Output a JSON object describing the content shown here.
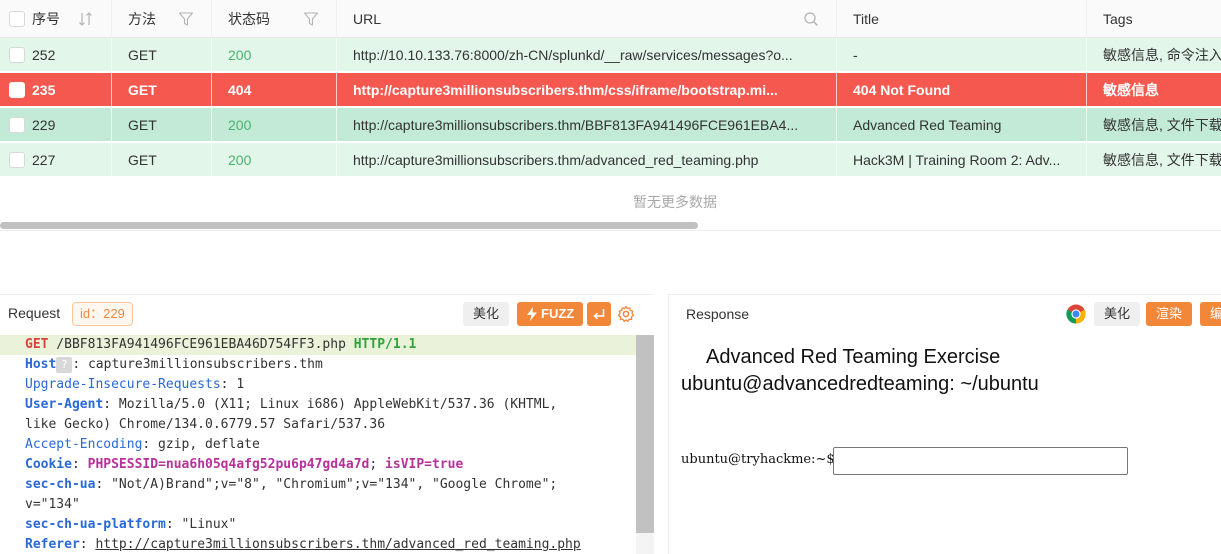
{
  "table": {
    "columns": {
      "index": "序号",
      "method": "方法",
      "status": "状态码",
      "url": "URL",
      "title": "Title",
      "tags": "Tags"
    },
    "rows": [
      {
        "index": "252",
        "method": "GET",
        "status": "200",
        "url": "http://10.10.133.76:8000/zh-CN/splunkd/__raw/services/messages?o...",
        "title": "-",
        "tags": "敏感信息, 命令注入",
        "state": "normal"
      },
      {
        "index": "235",
        "method": "GET",
        "status": "404",
        "url": "http://capture3millionsubscribers.thm/css/iframe/bootstrap.mi...",
        "title": "404 Not Found",
        "tags": "敏感信息",
        "state": "error-selected"
      },
      {
        "index": "229",
        "method": "GET",
        "status": "200",
        "url": "http://capture3millionsubscribers.thm/BBF813FA941496FCE961EBA4...",
        "title": "Advanced Red Teaming",
        "tags": "敏感信息, 文件下载",
        "state": "active"
      },
      {
        "index": "227",
        "method": "GET",
        "status": "200",
        "url": "http://capture3millionsubscribers.thm/advanced_red_teaming.php",
        "title": "Hack3M | Training Room 2: Adv...",
        "tags": "敏感信息, 文件下载",
        "state": "normal"
      }
    ],
    "empty_text": "暂无更多数据",
    "colors": {
      "row_normal": "#e2f6ea",
      "row_error": "#f4584e",
      "row_active": "#c2ead6",
      "status_ok": "#47b56f"
    }
  },
  "request": {
    "title": "Request",
    "id_badge": "id：229",
    "beautify_label": "美化",
    "fuzz_label": "FUZZ",
    "lines": {
      "method": "GET",
      "path": " /BBF813FA941496FCE961EBA46D754FF3.php ",
      "protocol": "HTTP/1.1",
      "host_key": "Host",
      "host_q": "?",
      "host_val": ": capture3millionsubscribers.thm",
      "uir_key": "Upgrade-Insecure-Requests",
      "uir_val": ": 1",
      "ua_key": "User-Agent",
      "ua_val": ": Mozilla/5.0 (X11; Linux i686) AppleWebKit/537.36 (KHTML,",
      "ua_val2": "like Gecko) Chrome/134.0.6779.57 Safari/537.36",
      "ae_key": "Accept-Encoding",
      "ae_val": ": gzip, deflate",
      "cookie_key": "Cookie",
      "cookie_sep": ": ",
      "cookie_val1": "PHPSESSID=nua6h05q4afg52pu6p47gd4a7d",
      "cookie_sep2": "; ",
      "cookie_val2": "isVIP=true",
      "secua_key": "sec-ch-ua",
      "secua_val": ": \"Not/A)Brand\";v=\"8\", \"Chromium\";v=\"134\", \"Google Chrome\";",
      "secua_val2": "v=\"134\"",
      "secplat_key": "sec-ch-ua-platform",
      "secplat_val": ": \"Linux\"",
      "ref_key": "Referer",
      "ref_sep": ": ",
      "ref_val": "http://capture3millionsubscribers.thm/advanced_red_teaming.php"
    }
  },
  "response": {
    "title": "Response",
    "beautify_label": "美化",
    "render_label": "渲染",
    "edit_label": "编",
    "heading1": "Advanced Red Teaming Exercise",
    "heading2": "ubuntu@advancedredteaming: ~/ubuntu",
    "prompt": "ubuntu@tryhackme:~$",
    "input_value": ""
  },
  "icons": {
    "sort": "sort-icon",
    "filter": "filter-icon",
    "search": "search-icon",
    "lightning": "lightning-icon",
    "enter": "enter-icon",
    "gear": "gear-icon",
    "chrome": "chrome-icon"
  }
}
